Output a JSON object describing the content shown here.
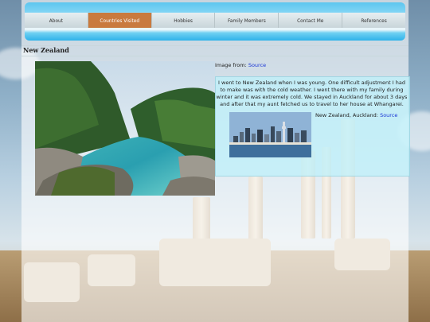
{
  "nav": {
    "items": [
      {
        "label": "About"
      },
      {
        "label": "Countries Visited"
      },
      {
        "label": "Hobbies"
      },
      {
        "label": "Family Members"
      },
      {
        "label": "Contact Me"
      },
      {
        "label": "References"
      }
    ],
    "active_color": "#c97a3e"
  },
  "section": {
    "title": "New Zealand"
  },
  "main_image": {
    "caption_prefix": "Image from:",
    "caption_link": "Source"
  },
  "story": {
    "text": "I went to New Zealand when I was young. One difficult adjustment I had to make was with the cold weather. I went there with my family during winter and it was extremely cold. We stayed in Auckland for about 3 days and after that my aunt fetched us to travel to her house at Whangarei."
  },
  "second_image": {
    "caption_prefix": "New Zealand, Auckland:",
    "caption_link": "Source"
  },
  "colors": {
    "header_blue": "#2fb2ea",
    "text_box": "#bef0fa",
    "link": "#1a35d6"
  }
}
